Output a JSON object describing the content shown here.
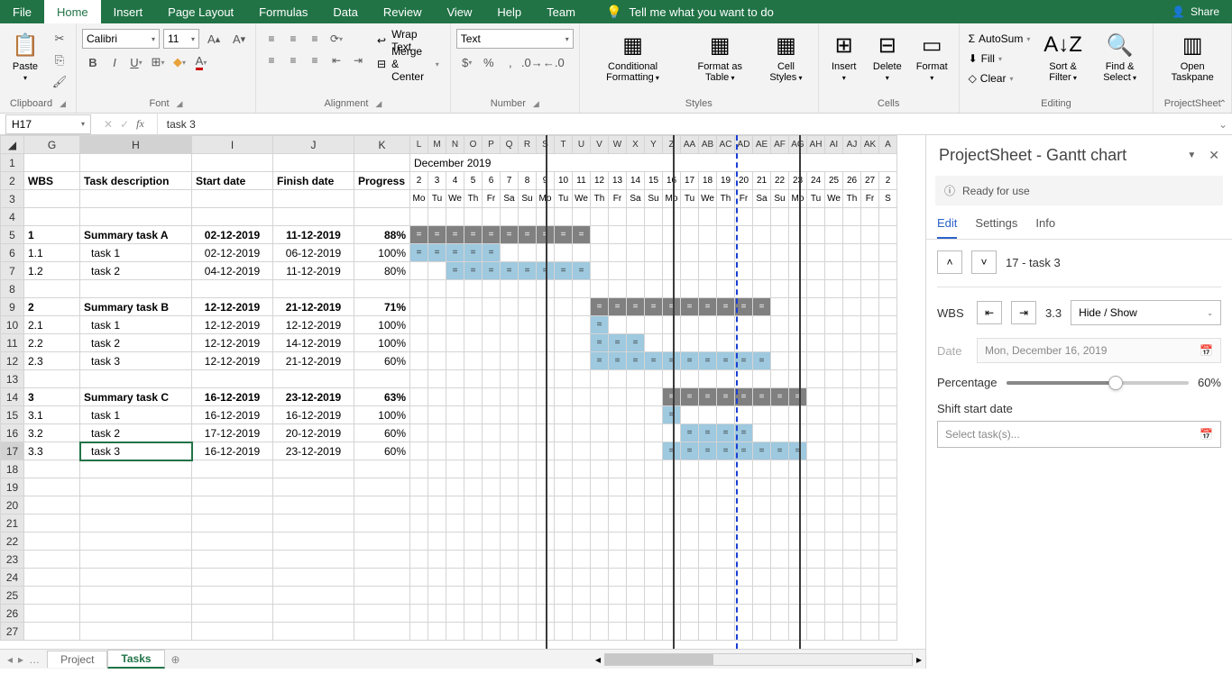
{
  "menubar": {
    "tabs": [
      "File",
      "Home",
      "Insert",
      "Page Layout",
      "Formulas",
      "Data",
      "Review",
      "View",
      "Help",
      "Team"
    ],
    "active": "Home",
    "tellme": "Tell me what you want to do",
    "share": "Share"
  },
  "ribbon": {
    "clipboard": {
      "paste": "Paste",
      "label": "Clipboard"
    },
    "font": {
      "name": "Calibri",
      "size": "11",
      "label": "Font"
    },
    "alignment": {
      "wrap": "Wrap Text",
      "merge": "Merge & Center",
      "label": "Alignment"
    },
    "number": {
      "format": "Text",
      "label": "Number"
    },
    "styles": {
      "cond": "Conditional Formatting",
      "table": "Format as Table",
      "cell": "Cell Styles",
      "label": "Styles"
    },
    "cells": {
      "insert": "Insert",
      "delete": "Delete",
      "format": "Format",
      "label": "Cells"
    },
    "editing": {
      "autosum": "AutoSum",
      "fill": "Fill",
      "clear": "Clear",
      "sort": "Sort & Filter",
      "find": "Find & Select",
      "label": "Editing"
    },
    "projectsheet": {
      "open": "Open Taskpane",
      "label": "ProjectSheet"
    }
  },
  "formulabar": {
    "cellref": "H17",
    "value": "   task 3"
  },
  "grid": {
    "columns": [
      "G",
      "H",
      "I",
      "J",
      "K",
      "L",
      "M",
      "N",
      "O",
      "P",
      "Q",
      "R",
      "S",
      "T",
      "U",
      "V",
      "W",
      "X",
      "Y",
      "Z",
      "AA",
      "AB",
      "AC",
      "AD",
      "AE",
      "AF",
      "AG",
      "AH",
      "AI",
      "AJ",
      "AK",
      "A"
    ],
    "month_header": "December 2019",
    "day_nums": [
      "2",
      "3",
      "4",
      "5",
      "6",
      "7",
      "8",
      "9",
      "10",
      "11",
      "12",
      "13",
      "14",
      "15",
      "16",
      "17",
      "18",
      "19",
      "20",
      "21",
      "22",
      "23",
      "24",
      "25",
      "26",
      "27",
      "2"
    ],
    "day_abbr": [
      "Mo",
      "Tu",
      "We",
      "Th",
      "Fr",
      "Sa",
      "Su",
      "Mo",
      "Tu",
      "We",
      "Th",
      "Fr",
      "Sa",
      "Su",
      "Mo",
      "Tu",
      "We",
      "Th",
      "Fr",
      "Sa",
      "Su",
      "Mo",
      "Tu",
      "We",
      "Th",
      "Fr",
      "S"
    ],
    "headers": {
      "wbs": "WBS",
      "desc": "Task description",
      "start": "Start date",
      "finish": "Finish date",
      "progress": "Progress"
    },
    "rows": [
      {
        "r": 5,
        "wbs": "1",
        "desc": "Summary task A",
        "start": "02-12-2019",
        "finish": "11-12-2019",
        "prog": "88%",
        "bold": true,
        "bar": {
          "from": 0,
          "to": 9,
          "type": "summary"
        }
      },
      {
        "r": 6,
        "wbs": "1.1",
        "desc": "task 1",
        "start": "02-12-2019",
        "finish": "06-12-2019",
        "prog": "100%",
        "bar": {
          "from": 0,
          "to": 4,
          "type": "task"
        }
      },
      {
        "r": 7,
        "wbs": "1.2",
        "desc": "task 2",
        "start": "04-12-2019",
        "finish": "11-12-2019",
        "prog": "80%",
        "bar": {
          "from": 2,
          "to": 9,
          "type": "task"
        }
      },
      {
        "r": 8
      },
      {
        "r": 9,
        "wbs": "2",
        "desc": "Summary task B",
        "start": "12-12-2019",
        "finish": "21-12-2019",
        "prog": "71%",
        "bold": true,
        "bar": {
          "from": 10,
          "to": 19,
          "type": "summary"
        }
      },
      {
        "r": 10,
        "wbs": "2.1",
        "desc": "task 1",
        "start": "12-12-2019",
        "finish": "12-12-2019",
        "prog": "100%",
        "bar": {
          "from": 10,
          "to": 10,
          "type": "task"
        }
      },
      {
        "r": 11,
        "wbs": "2.2",
        "desc": "task 2",
        "start": "12-12-2019",
        "finish": "14-12-2019",
        "prog": "100%",
        "bar": {
          "from": 10,
          "to": 12,
          "type": "task"
        }
      },
      {
        "r": 12,
        "wbs": "2.3",
        "desc": "task 3",
        "start": "12-12-2019",
        "finish": "21-12-2019",
        "prog": "60%",
        "bar": {
          "from": 10,
          "to": 19,
          "type": "task"
        }
      },
      {
        "r": 13
      },
      {
        "r": 14,
        "wbs": "3",
        "desc": "Summary task C",
        "start": "16-12-2019",
        "finish": "23-12-2019",
        "prog": "63%",
        "bold": true,
        "bar": {
          "from": 14,
          "to": 21,
          "type": "summary"
        }
      },
      {
        "r": 15,
        "wbs": "3.1",
        "desc": "task 1",
        "start": "16-12-2019",
        "finish": "16-12-2019",
        "prog": "100%",
        "bar": {
          "from": 14,
          "to": 14,
          "type": "task"
        }
      },
      {
        "r": 16,
        "wbs": "3.2",
        "desc": "task 2",
        "start": "17-12-2019",
        "finish": "20-12-2019",
        "prog": "60%",
        "bar": {
          "from": 15,
          "to": 18,
          "type": "task"
        }
      },
      {
        "r": 17,
        "wbs": "3.3",
        "desc": "task 3",
        "start": "16-12-2019",
        "finish": "23-12-2019",
        "prog": "60%",
        "bar": {
          "from": 14,
          "to": 21,
          "type": "task"
        },
        "selected": true
      },
      {
        "r": 18
      },
      {
        "r": 19
      },
      {
        "r": 20
      },
      {
        "r": 21
      },
      {
        "r": 22
      },
      {
        "r": 23
      },
      {
        "r": 24
      },
      {
        "r": 25
      },
      {
        "r": 26
      },
      {
        "r": 27
      }
    ],
    "active_col": "H",
    "active_row": 17
  },
  "sheettabs": {
    "tabs": [
      "Project",
      "Tasks"
    ],
    "active": "Tasks"
  },
  "taskpane": {
    "title": "ProjectSheet - Gantt chart",
    "status": "Ready for use",
    "tabs": [
      "Edit",
      "Settings",
      "Info"
    ],
    "active_tab": "Edit",
    "current": "17 - task 3",
    "wbs_label": "WBS",
    "wbs_value": "3.3",
    "hide_show": "Hide / Show",
    "date_label": "Date",
    "date_value": "Mon, December 16, 2019",
    "pct_label": "Percentage",
    "pct_value": "60%",
    "pct_num": 60,
    "shift_label": "Shift start date",
    "shift_placeholder": "Select task(s)..."
  }
}
